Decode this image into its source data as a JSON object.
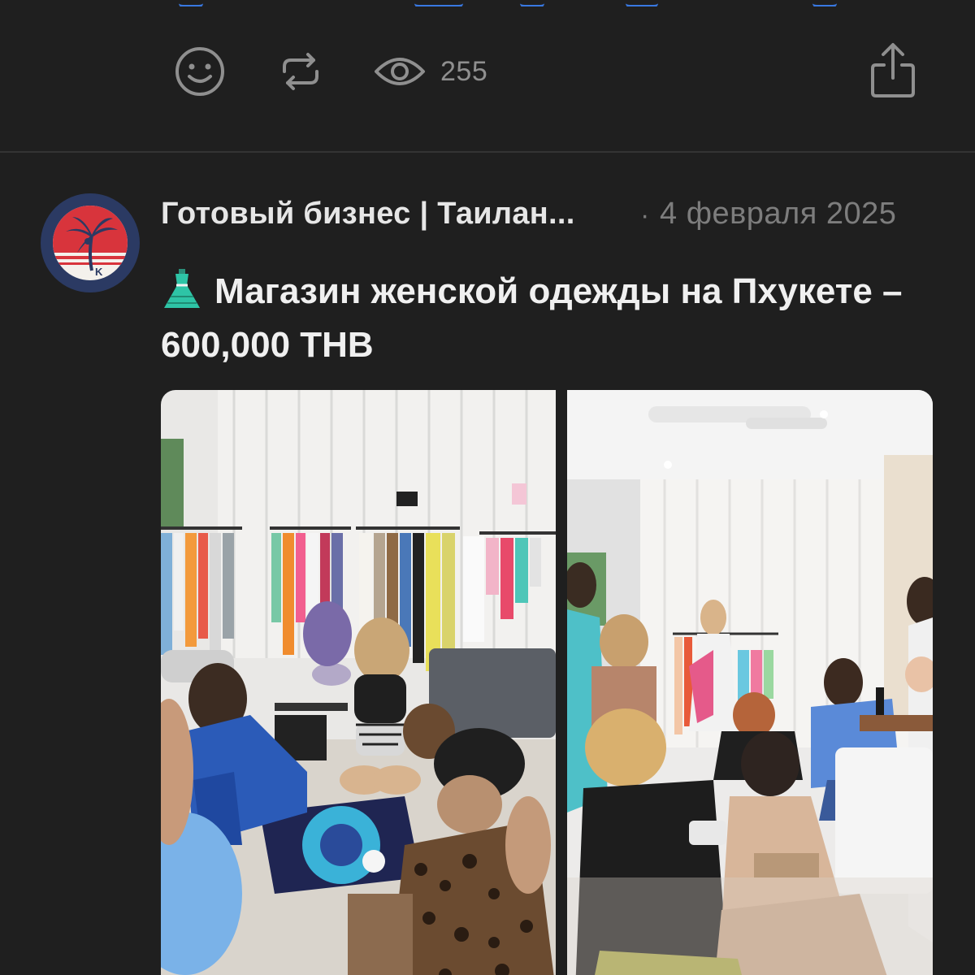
{
  "previous_post": {
    "views_count": "255"
  },
  "post": {
    "author": "Готовый бизнес | Таилан...",
    "date_separator": "·",
    "date": "4 февраля 2025",
    "title_emoji": "dress-icon",
    "title": "Магазин женской одежды на Пхукете – 600,000 THB"
  },
  "icons": {
    "reaction": "smiley-icon",
    "repost": "repost-icon",
    "views": "eye-icon",
    "share": "share-icon",
    "avatar": "palm-tree-logo"
  },
  "colors": {
    "background": "#1f1f1f",
    "icon_gray": "#8f8f8f",
    "avatar_ring": "#2b3a63",
    "avatar_red": "#d8343c",
    "dress": "#2ec4a6"
  }
}
